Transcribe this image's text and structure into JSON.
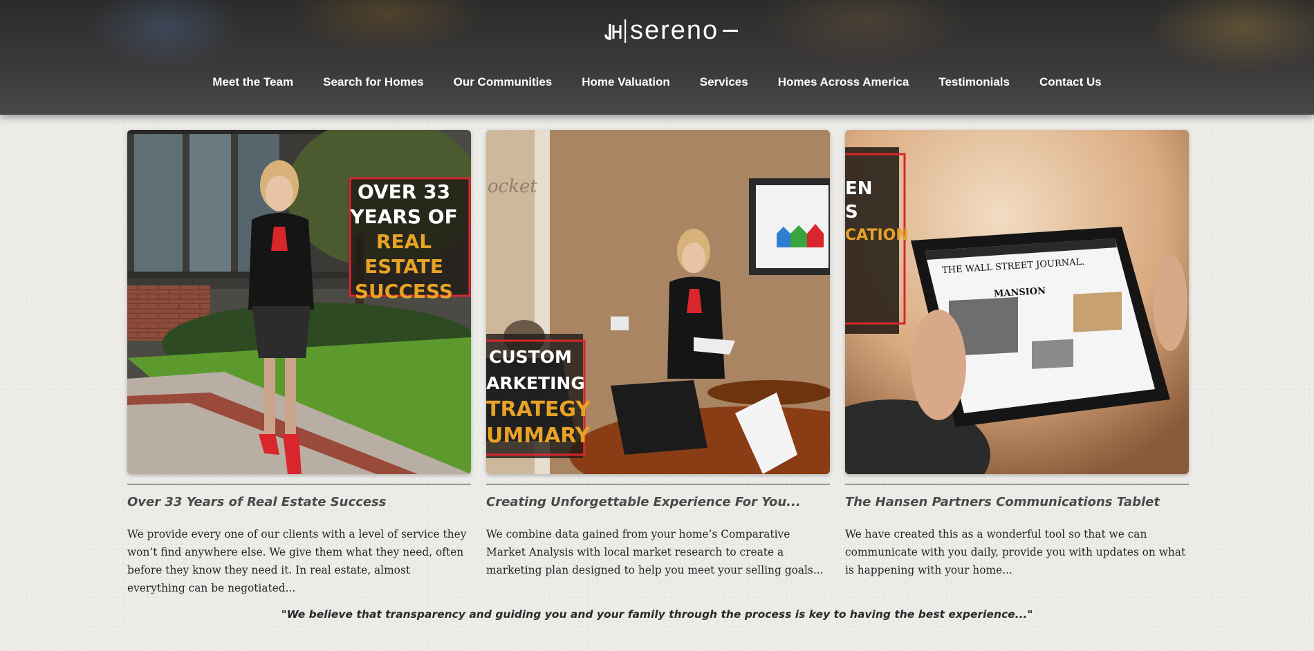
{
  "brand": {
    "logo_text": "sereno",
    "logo_mark": "JH monogram"
  },
  "nav": {
    "items": [
      "Meet the Team",
      "Search for Homes",
      "Our Communities",
      "Home Valuation",
      "Services",
      "Homes Across America",
      "Testimonials",
      "Contact Us"
    ]
  },
  "cards": [
    {
      "image_overlay": {
        "line1": "OVER 33",
        "line2": "YEARS OF",
        "line3": "REAL ESTATE",
        "line4": "SUCCESS"
      },
      "title": "Over 33 Years of Real Estate Success",
      "body": "We provide every one of our clients with a level of service they won’t find anywhere else. We give them what they need, often before they know they need it. In real estate, almost everything can be negotiated..."
    },
    {
      "image_overlay": {
        "line1": "CUSTOM",
        "line2": "ARKETING",
        "line3": "TRATEGY",
        "line4": "UMMARY"
      },
      "title": "Creating Unforgettable Experience For You...",
      "body": "We combine data gained from your home’s Comparative Market Analysis with local market research to create a marketing plan designed to help you meet your selling goals..."
    },
    {
      "image_overlay": {
        "line1": "EN",
        "line2": "S",
        "line3": "CATION"
      },
      "tablet_headline": "THE WALL STREET JOURNAL.",
      "tablet_sub": "MANSION",
      "title": "The Hansen Partners Communications Tablet",
      "body": "We have created this as a wonderful tool so that we can communicate with you daily, provide you with updates on what is happening with your home..."
    }
  ],
  "quote": "\"We believe that transparency and guiding you and your family through the process is key to having the best experience...\"",
  "colors": {
    "accent_gold": "#e8a226",
    "accent_red": "#d8262c",
    "text_dark": "#262626"
  }
}
